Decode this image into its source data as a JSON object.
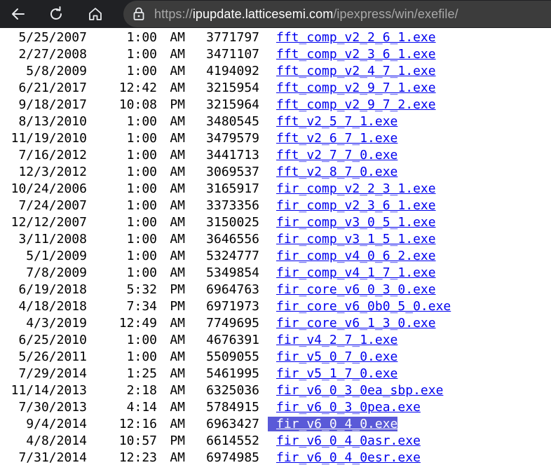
{
  "browser": {
    "url_prefix": "https://",
    "url_host": "ipupdate.latticesemi.com",
    "url_path": "/ipexpress/win/exefile/",
    "icons": {
      "back": "arrow-left-icon",
      "reload": "reload-icon",
      "home": "home-icon",
      "lock": "lock-icon"
    }
  },
  "listing": {
    "selected_index": 23,
    "rows": [
      {
        "date": "5/25/2007",
        "time": "1:00",
        "ampm": "AM",
        "size": "3771797",
        "name": "fft_comp_v2_2_6_1.exe"
      },
      {
        "date": "2/27/2008",
        "time": "1:00",
        "ampm": "AM",
        "size": "3471107",
        "name": "fft_comp_v2_3_6_1.exe"
      },
      {
        "date": "5/8/2009",
        "time": "1:00",
        "ampm": "AM",
        "size": "4194092",
        "name": "fft_comp_v2_4_7_1.exe"
      },
      {
        "date": "6/21/2017",
        "time": "12:42",
        "ampm": "AM",
        "size": "3215954",
        "name": "fft_comp_v2_9_7_1.exe"
      },
      {
        "date": "9/18/2017",
        "time": "10:08",
        "ampm": "PM",
        "size": "3215964",
        "name": "fft_comp_v2_9_7_2.exe"
      },
      {
        "date": "8/13/2010",
        "time": "1:00",
        "ampm": "AM",
        "size": "3480545",
        "name": "fft_v2_5_7_1.exe"
      },
      {
        "date": "11/19/2010",
        "time": "1:00",
        "ampm": "AM",
        "size": "3479579",
        "name": "fft_v2_6_7_1.exe"
      },
      {
        "date": "7/16/2012",
        "time": "1:00",
        "ampm": "AM",
        "size": "3441713",
        "name": "fft_v2_7_7_0.exe"
      },
      {
        "date": "12/3/2012",
        "time": "1:00",
        "ampm": "AM",
        "size": "3069537",
        "name": "fft_v2_8_7_0.exe"
      },
      {
        "date": "10/24/2006",
        "time": "1:00",
        "ampm": "AM",
        "size": "3165917",
        "name": "fir_comp_v2_2_3_1.exe"
      },
      {
        "date": "7/24/2007",
        "time": "1:00",
        "ampm": "AM",
        "size": "3373356",
        "name": "fir_comp_v2_3_6_1.exe"
      },
      {
        "date": "12/12/2007",
        "time": "1:00",
        "ampm": "AM",
        "size": "3150025",
        "name": "fir_comp_v3_0_5_1.exe"
      },
      {
        "date": "3/11/2008",
        "time": "1:00",
        "ampm": "AM",
        "size": "3646556",
        "name": "fir_comp_v3_1_5_1.exe"
      },
      {
        "date": "5/1/2009",
        "time": "1:00",
        "ampm": "AM",
        "size": "5324777",
        "name": "fir_comp_v4_0_6_2.exe"
      },
      {
        "date": "7/8/2009",
        "time": "1:00",
        "ampm": "AM",
        "size": "5349854",
        "name": "fir_comp_v4_1_7_1.exe"
      },
      {
        "date": "6/19/2018",
        "time": "5:32",
        "ampm": "PM",
        "size": "6964763",
        "name": "fir_core_v6_0_3_0.exe"
      },
      {
        "date": "4/18/2018",
        "time": "7:34",
        "ampm": "PM",
        "size": "6971973",
        "name": "fir_core_v6_0b0_5_0.exe"
      },
      {
        "date": "4/3/2019",
        "time": "12:49",
        "ampm": "AM",
        "size": "7749695",
        "name": "fir_core_v6_1_3_0.exe"
      },
      {
        "date": "6/25/2010",
        "time": "1:00",
        "ampm": "AM",
        "size": "4676391",
        "name": "fir_v4_2_7_1.exe"
      },
      {
        "date": "5/26/2011",
        "time": "1:00",
        "ampm": "AM",
        "size": "5509055",
        "name": "fir_v5_0_7_0.exe"
      },
      {
        "date": "7/29/2014",
        "time": "1:25",
        "ampm": "AM",
        "size": "5461995",
        "name": "fir_v5_1_7_0.exe"
      },
      {
        "date": "11/14/2013",
        "time": "2:18",
        "ampm": "AM",
        "size": "6325036",
        "name": "fir_v6_0_3_0ea_sbp.exe"
      },
      {
        "date": "7/30/2013",
        "time": "4:14",
        "ampm": "AM",
        "size": "5784915",
        "name": "fir_v6_0_3_0pea.exe"
      },
      {
        "date": "9/4/2014",
        "time": "12:16",
        "ampm": "AM",
        "size": "6963427",
        "name": "fir_v6_0_4_0.exe"
      },
      {
        "date": "4/8/2014",
        "time": "10:57",
        "ampm": "PM",
        "size": "6614552",
        "name": "fir_v6_0_4_0asr.exe"
      },
      {
        "date": "7/31/2014",
        "time": "12:23",
        "ampm": "AM",
        "size": "6974985",
        "name": "fir_v6_0_4_0esr.exe"
      }
    ]
  }
}
